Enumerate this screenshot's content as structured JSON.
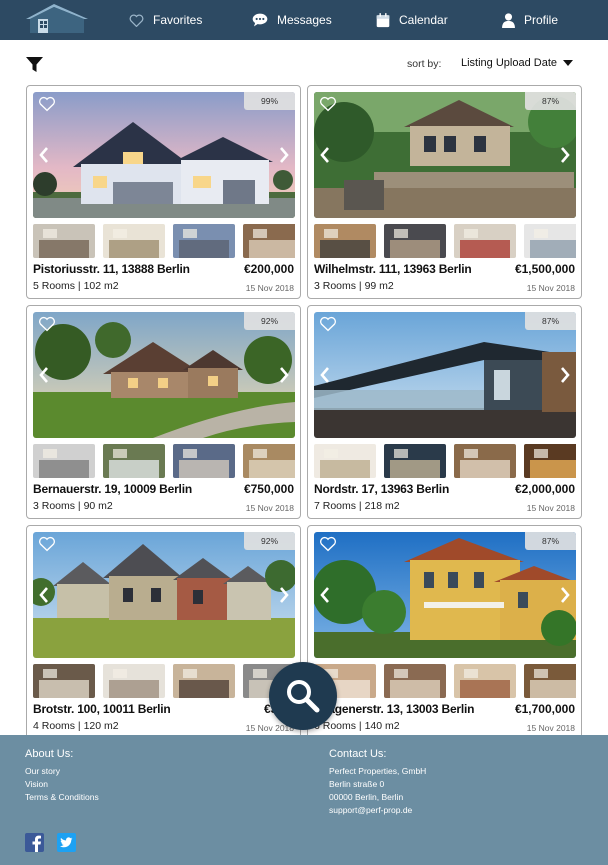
{
  "nav": {
    "favorites": "Favorites",
    "messages": "Messages",
    "calendar": "Calendar",
    "profile": "Profile"
  },
  "sort": {
    "label": "sort by:",
    "value": "Listing Upload Date"
  },
  "listings": [
    {
      "score": "99%",
      "address": "Pistoriusstr. 11, 13888 Berlin",
      "price": "€200,000",
      "meta": "5 Rooms | 102 m2",
      "date": "15 Nov 2018"
    },
    {
      "score": "87%",
      "address": "Wilhelmstr. 111, 13963 Berlin",
      "price": "€1,500,000",
      "meta": "3 Rooms | 99 m2",
      "date": "15 Nov 2018"
    },
    {
      "score": "92%",
      "address": "Bernauerstr. 19, 10009 Berlin",
      "price": "€750,000",
      "meta": "3 Rooms | 90 m2",
      "date": "15 Nov 2018"
    },
    {
      "score": "87%",
      "address": "Nordstr. 17, 13963 Berlin",
      "price": "€2,000,000",
      "meta": "7 Rooms | 218 m2",
      "date": "15 Nov 2018"
    },
    {
      "score": "92%",
      "address": "Brotstr. 100, 10011 Berlin",
      "price": "€320,",
      "meta": "4 Rooms | 120 m2",
      "date": "15 Nov 2018"
    },
    {
      "score": "87%",
      "address": "nhagenerstr. 13, 13003 Berlin",
      "price": "€1,700,000",
      "meta": "6 Rooms | 140 m2",
      "date": "15 Nov 2018"
    }
  ],
  "footer": {
    "about_title": "About Us:",
    "about_links": [
      "Our story",
      "Vision",
      "Terms & Conditions"
    ],
    "contact_title": "Contact Us:",
    "contact_lines": [
      "Perfect Properties, GmbH",
      "Berlin straße 0",
      "00000 Berlin, Berlin",
      "support@perf-prop.de"
    ]
  },
  "colors": {
    "nav_bg": "#2d4a63",
    "footer_bg": "#6c8ea2",
    "fab_bg": "#1f3a50",
    "facebook": "#3b5998",
    "twitter": "#1da1f2"
  },
  "icons": [
    "house-logo",
    "heart-icon",
    "chat-bubble-icon",
    "calendar-icon",
    "person-icon",
    "filter-icon",
    "caret-down-icon",
    "search-icon",
    "facebook-icon",
    "twitter-icon",
    "chevron-left-icon",
    "chevron-right-icon"
  ]
}
